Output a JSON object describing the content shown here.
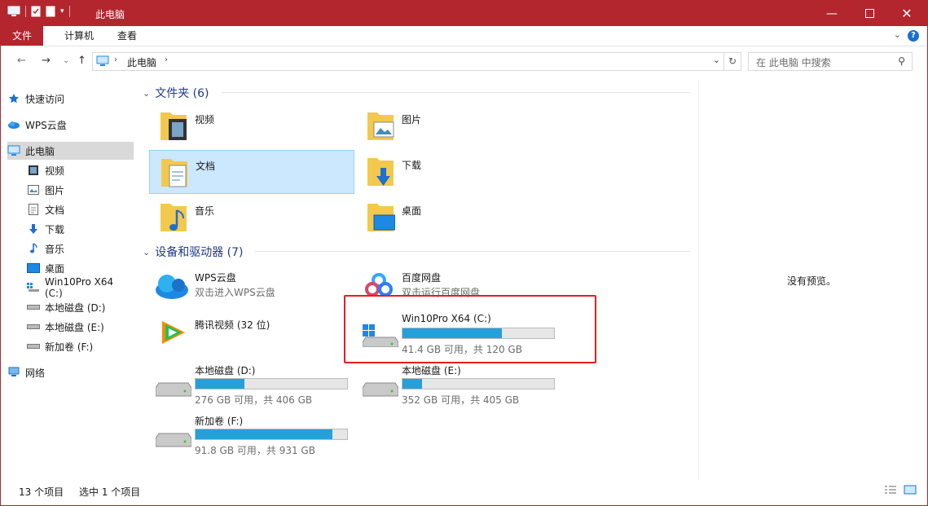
{
  "window": {
    "title": "此电脑",
    "colors": {
      "accent": "#b3262e",
      "selection": "#cce8ff",
      "bar": "#26a0da",
      "highlight": "#e02020"
    }
  },
  "ribbon": {
    "tabs": [
      "文件",
      "计算机",
      "查看"
    ]
  },
  "address": {
    "crumb": "此电脑",
    "search_placeholder": "在 此电脑 中搜索"
  },
  "sidebar": {
    "items": [
      {
        "label": "快速访问",
        "icon": "star-icon"
      },
      {
        "label": "WPS云盘",
        "icon": "cloud-icon"
      },
      {
        "label": "此电脑",
        "icon": "pc-icon",
        "active": true
      },
      {
        "label": "视频",
        "icon": "video-icon"
      },
      {
        "label": "图片",
        "icon": "picture-icon"
      },
      {
        "label": "文档",
        "icon": "document-icon"
      },
      {
        "label": "下载",
        "icon": "download-icon"
      },
      {
        "label": "音乐",
        "icon": "music-icon"
      },
      {
        "label": "桌面",
        "icon": "desktop-icon"
      },
      {
        "label": "Win10Pro X64 (C:)",
        "icon": "system-drive-icon"
      },
      {
        "label": "本地磁盘 (D:)",
        "icon": "drive-icon"
      },
      {
        "label": "本地磁盘 (E:)",
        "icon": "drive-icon"
      },
      {
        "label": "新加卷 (F:)",
        "icon": "drive-icon"
      },
      {
        "label": "网络",
        "icon": "network-icon"
      }
    ]
  },
  "main": {
    "folders_header": "文件夹 (6)",
    "folders": [
      "视频",
      "图片",
      "文档",
      "下载",
      "音乐",
      "桌面"
    ],
    "devices_header": "设备和驱动器 (7)",
    "apps": [
      {
        "name": "WPS云盘",
        "sub": "双击进入WPS云盘"
      },
      {
        "name": "百度网盘",
        "sub": "双击运行百度网盘"
      },
      {
        "name": "腾讯视频 (32 位)",
        "sub": ""
      }
    ],
    "drives": [
      {
        "name": "Win10Pro X64 (C:)",
        "free": "41.4 GB 可用，共 120 GB",
        "used_fraction": 0.655
      },
      {
        "name": "本地磁盘 (D:)",
        "free": "276 GB 可用，共 406 GB",
        "used_fraction": 0.32
      },
      {
        "name": "本地磁盘 (E:)",
        "free": "352 GB 可用，共 405 GB",
        "used_fraction": 0.131
      },
      {
        "name": "新加卷 (F:)",
        "free": "91.8 GB 可用，共 931 GB",
        "used_fraction": 0.901
      }
    ]
  },
  "preview": {
    "text": "没有预览。"
  },
  "status": {
    "count": "13 个项目",
    "selected": "选中 1 个项目"
  }
}
